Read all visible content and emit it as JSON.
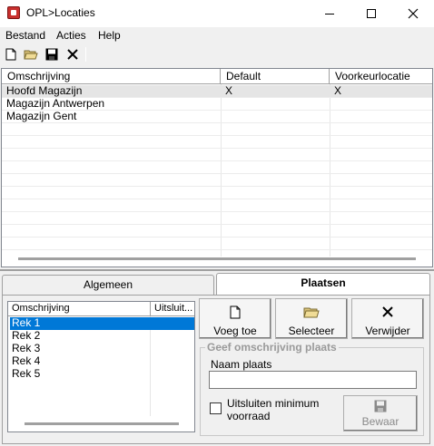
{
  "window": {
    "title": "OPL>Locaties"
  },
  "menu": {
    "items": [
      "Bestand",
      "Acties",
      "Help"
    ]
  },
  "toolbar": {
    "buttons": [
      "new-document-icon",
      "open-folder-icon",
      "save-disk-icon",
      "delete-x-icon"
    ]
  },
  "grid": {
    "columns": [
      "Omschrijving",
      "Default",
      "Voorkeurlocatie"
    ],
    "rows": [
      {
        "omschrijving": "Hoofd Magazijn",
        "default": "X",
        "voorkeur": "X"
      },
      {
        "omschrijving": "Magazijn Antwerpen",
        "default": "",
        "voorkeur": ""
      },
      {
        "omschrijving": "Magazijn Gent",
        "default": "",
        "voorkeur": ""
      }
    ]
  },
  "tabs": [
    {
      "label": "Algemeen",
      "active": false
    },
    {
      "label": "Plaatsen",
      "active": true
    }
  ],
  "plaatsen": {
    "columns": [
      "Omschrijving",
      "Uitsluit..."
    ],
    "rows": [
      "Rek 1",
      "Rek 2",
      "Rek 3",
      "Rek 4",
      "Rek 5"
    ],
    "buttons": {
      "voeg_toe": {
        "label": "Voeg toe",
        "icon": "new-document-icon"
      },
      "selecteer": {
        "label": "Selecteer",
        "icon": "open-folder-icon"
      },
      "verwijder": {
        "label": "Verwijder",
        "icon": "delete-x-icon"
      }
    },
    "group": {
      "title": "Geef omschrijving plaats",
      "naam_label": "Naam plaats",
      "naam_value": "",
      "uitsluiten_label": "Uitsluiten minimum voorraad",
      "bewaar_label": "Bewaar"
    }
  },
  "colors": {
    "selection": "#0078d7",
    "title_bg": "#ffffff",
    "window_bg": "#f0f0f0"
  }
}
